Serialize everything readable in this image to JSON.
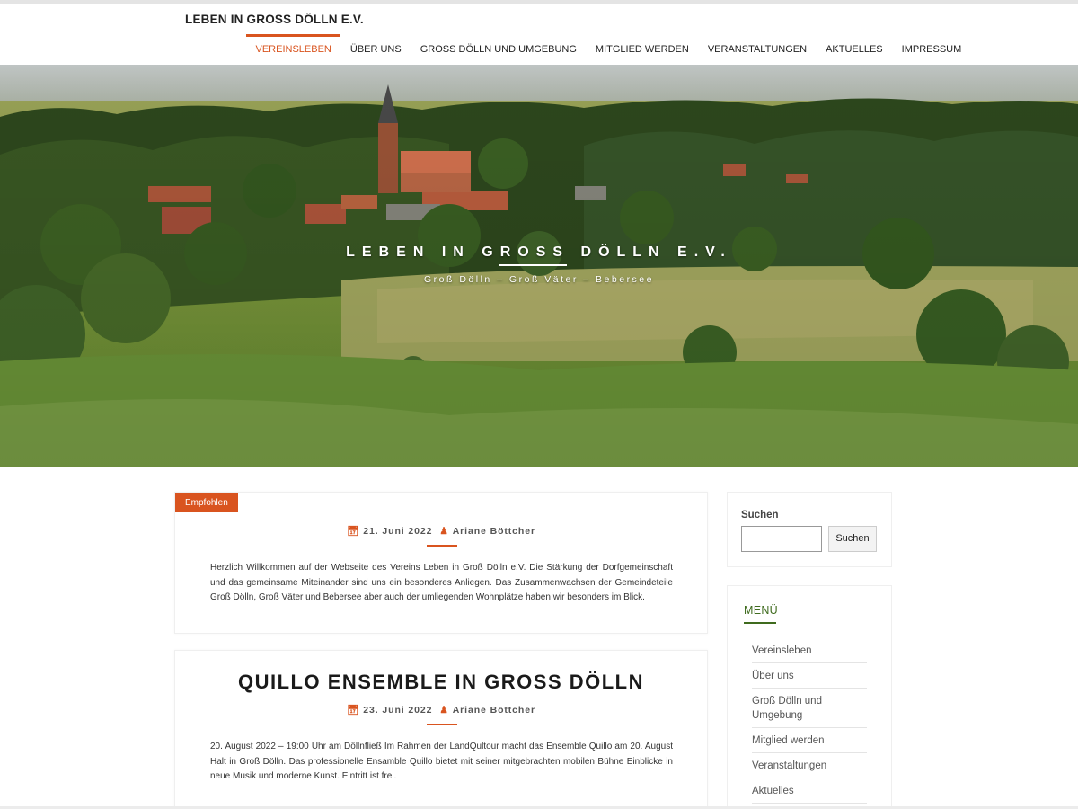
{
  "header": {
    "site_title": "LEBEN IN GROSS DÖLLN E.V.",
    "nav": [
      {
        "label": "VEREINSLEBEN",
        "active": true
      },
      {
        "label": "ÜBER UNS",
        "active": false
      },
      {
        "label": "GROSS DÖLLN UND UMGEBUNG",
        "active": false
      },
      {
        "label": "MITGLIED WERDEN",
        "active": false
      },
      {
        "label": "VERANSTALTUNGEN",
        "active": false
      },
      {
        "label": "AKTUELLES",
        "active": false
      },
      {
        "label": "IMPRESSUM",
        "active": false
      }
    ]
  },
  "hero": {
    "title": "LEBEN IN GROSS DÖLLN E.V.",
    "subtitle": "Groß Dölln – Groß Väter – Bebersee"
  },
  "posts": [
    {
      "badge": "Empfohlen",
      "title": "",
      "date": "21. Juni 2022",
      "author": "Ariane Böttcher",
      "excerpt": "Herzlich Willkommen auf der Webseite des Vereins Leben in Groß Dölln e.V. Die Stärkung der Dorfgemeinschaft und das gemeinsame Miteinander sind uns ein besonderes Anliegen. Das Zusammenwachsen der Gemeindeteile Groß Dölln, Groß Väter und Bebersee aber auch der umliegenden Wohnplätze haben wir besonders im Blick."
    },
    {
      "badge": "",
      "title": "QUILLO ENSEMBLE IN GROSS DÖLLN",
      "date": "23. Juni 2022",
      "author": "Ariane Böttcher",
      "excerpt": "20. August 2022 – 19:00 Uhr am Döllnfließ Im Rahmen der LandQultour macht das Ensemble Quillo am 20. August Halt in Groß Dölln. Das professionelle Ensamble Quillo bietet mit seiner mitgebrachten mobilen Bühne Einblicke in neue Musik und moderne Kunst. Eintritt ist frei."
    }
  ],
  "sidebar": {
    "search": {
      "label": "Suchen",
      "value": "",
      "button": "Suchen"
    },
    "menu": {
      "title": "MENÜ",
      "items": [
        "Vereinsleben",
        "Über uns",
        "Groß Dölln und Umgebung",
        "Mitglied werden",
        "Veranstaltungen",
        "Aktuelles"
      ]
    }
  },
  "icons": {
    "calendar": "calendar-icon",
    "user": "user-icon"
  },
  "colors": {
    "accent": "#d9541f",
    "menu_accent": "#3f6b1e"
  }
}
